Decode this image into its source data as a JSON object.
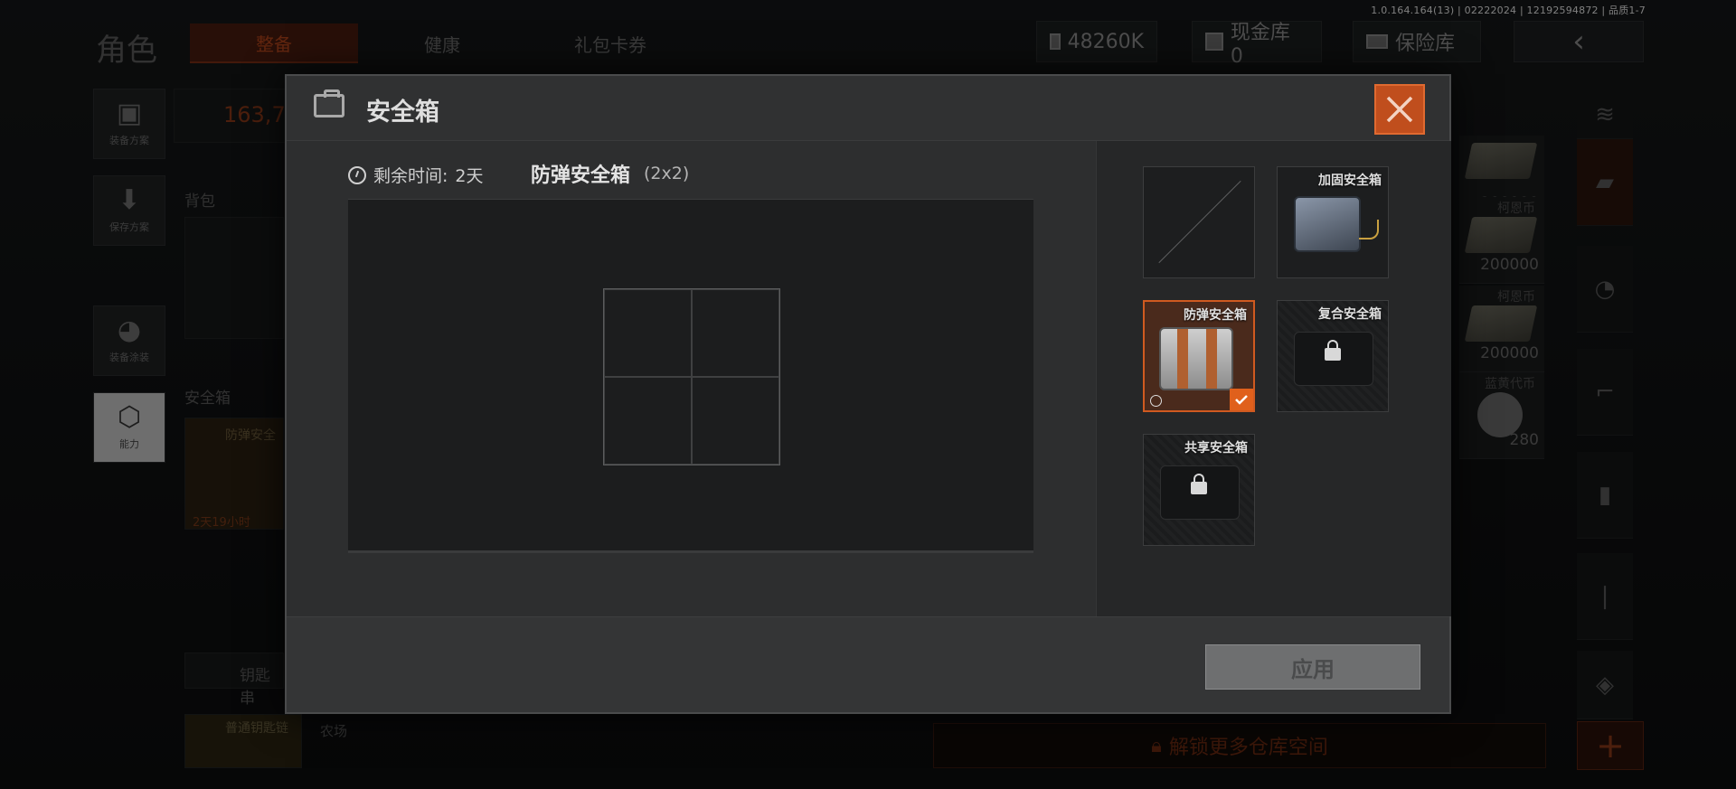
{
  "version_info": "1.0.164.164(13) | 02222024 | 12192594872 | 品质1-7",
  "background": {
    "page_title": "角色",
    "tabs": [
      "整备",
      "健康",
      "礼包卡券"
    ],
    "currency_amount": "48260K",
    "cash_vault_label": "现金库 0",
    "insurance_label": "保险库",
    "side_buttons": [
      "装备方案",
      "保存方案",
      "装备涂装",
      "能力"
    ],
    "stat_value": "163,7",
    "backpack_label": "背包",
    "safe_label": "安全箱",
    "safe_item_name": "防弹安全",
    "safe_item_timer": "2天19小时",
    "key_chain_label": "钥匙串",
    "keychain_item": "普通钥匙链",
    "farm_label": "农场",
    "money_items": [
      {
        "label": "",
        "value": "200000"
      },
      {
        "label": "柯恩币",
        "value": "200000"
      },
      {
        "label": "柯恩币",
        "value": "200000"
      },
      {
        "label": "蓝黄代币",
        "value": "280"
      }
    ],
    "unlock_text": "解锁更多仓库空间",
    "plus_symbol": "+"
  },
  "modal": {
    "title": "安全箱",
    "remaining_label": "剩余时间:",
    "remaining_value": "2天",
    "selected_box_name": "防弹安全箱",
    "selected_box_size": "(2x2)",
    "grid": {
      "cols": 2,
      "rows": 2
    },
    "options": [
      {
        "name": "",
        "state": "empty"
      },
      {
        "name": "加固安全箱",
        "state": "available"
      },
      {
        "name": "防弹安全箱",
        "state": "selected"
      },
      {
        "name": "复合安全箱",
        "state": "locked"
      },
      {
        "name": "共享安全箱",
        "state": "locked"
      }
    ],
    "apply_label": "应用"
  },
  "colors": {
    "accent": "#d05a20",
    "close_bg": "#c04e1d",
    "selected_bg": "#4a2a1c"
  }
}
